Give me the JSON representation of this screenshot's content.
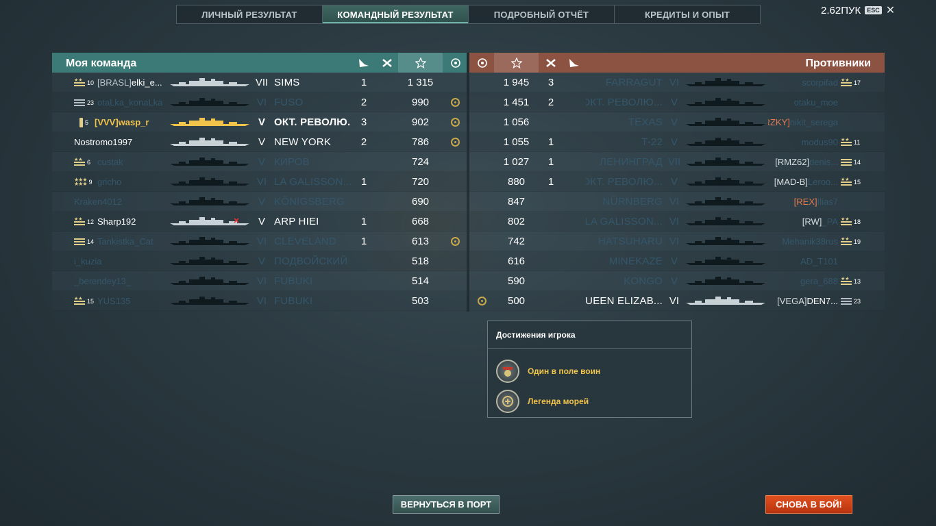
{
  "tabs": [
    {
      "label": "ЛИЧНЫЙ РЕЗУЛЬТАТ",
      "active": false
    },
    {
      "label": "КОМАНДНЫЙ РЕЗУЛЬТАТ",
      "active": true
    },
    {
      "label": "ПОДРОБНЫЙ ОТЧЁТ",
      "active": false
    },
    {
      "label": "КРЕДИТЫ И ОПЫТ",
      "active": false
    }
  ],
  "topbar": {
    "credits": "2.62ПУК",
    "esc_label": "ESC",
    "close_glyph": "✕"
  },
  "my_team": {
    "title": "Моя команда",
    "header_icons": [
      "ship-kill-icon",
      "plane-kill-icon",
      "star-icon",
      "helm-icon"
    ],
    "rows": [
      {
        "rank_num": "10",
        "insignia": "stripes-stars",
        "clan": "[BRASL]",
        "player": "elki_e...",
        "ship": "SIMS",
        "tier": "VII",
        "kills": "1",
        "plane_kills": "",
        "exp": "1 315",
        "medal": false,
        "alive": true,
        "me": false
      },
      {
        "rank_num": "23",
        "insignia": "bars",
        "clan": "",
        "player": "otaLka_konaLka",
        "ship": "FUSO",
        "tier": "VI",
        "kills": "2",
        "plane_kills": "",
        "exp": "990",
        "medal": true,
        "alive": false,
        "me": false
      },
      {
        "rank_num": "5",
        "insignia": "pill",
        "clan": "[VVV]",
        "player": "wasp_r",
        "ship": "ОКТ. РЕВОЛЮ...",
        "tier": "V",
        "kills": "3",
        "plane_kills": "",
        "exp": "902",
        "medal": true,
        "alive": true,
        "me": true
      },
      {
        "rank_num": "",
        "insignia": "",
        "clan": "",
        "player": "Nostromo1997",
        "ship": "NEW YORK",
        "tier": "V",
        "kills": "2",
        "plane_kills": "",
        "exp": "786",
        "medal": true,
        "alive": true,
        "me": false
      },
      {
        "rank_num": "6",
        "insignia": "stars-stripes",
        "clan": "",
        "player": "custak",
        "ship": "КИРОВ",
        "tier": "V",
        "kills": "",
        "plane_kills": "",
        "exp": "724",
        "medal": false,
        "alive": false,
        "me": false
      },
      {
        "rank_num": "9",
        "insignia": "stars",
        "clan": "",
        "player": "gricho",
        "ship": "LA GALISSON...",
        "tier": "VI",
        "kills": "1",
        "plane_kills": "",
        "exp": "720",
        "medal": false,
        "alive": false,
        "me": false
      },
      {
        "rank_num": "",
        "insignia": "",
        "clan": "",
        "player": "Kraken4012",
        "ship": "KÖNIGSBERG",
        "tier": "V",
        "kills": "",
        "plane_kills": "",
        "exp": "690",
        "medal": false,
        "alive": false,
        "me": false
      },
      {
        "rank_num": "12",
        "insignia": "stars-stripes",
        "clan": "",
        "player": "Sharp192",
        "ship": "ARP HIEI",
        "tier": "V",
        "kills": "1",
        "plane_kills": "",
        "exp": "668",
        "medal": false,
        "alive": true,
        "me": false
      },
      {
        "rank_num": "14",
        "insignia": "stripes",
        "clan": "",
        "player": "Tankistka_Cat",
        "ship": "CLEVELAND",
        "tier": "VI",
        "kills": "1",
        "plane_kills": "",
        "exp": "613",
        "medal": true,
        "alive": false,
        "me": false
      },
      {
        "rank_num": "",
        "insignia": "",
        "clan": "",
        "player": "i_kuzia",
        "ship": "ПОДВОЙСКИЙ",
        "tier": "V",
        "kills": "",
        "plane_kills": "",
        "exp": "518",
        "medal": false,
        "alive": false,
        "me": false
      },
      {
        "rank_num": "",
        "insignia": "",
        "clan": "",
        "player": "_berendey13_",
        "ship": "FUBUKI",
        "tier": "VI",
        "kills": "",
        "plane_kills": "",
        "exp": "514",
        "medal": false,
        "alive": false,
        "me": false
      },
      {
        "rank_num": "15",
        "insignia": "stars-stripes",
        "clan": "",
        "player": "YUS135",
        "ship": "FUBUKI",
        "tier": "VI",
        "kills": "",
        "plane_kills": "",
        "exp": "503",
        "medal": false,
        "alive": false,
        "me": false
      }
    ]
  },
  "enemies": {
    "title": "Противники",
    "header_icons": [
      "helm-icon",
      "star-icon",
      "plane-kill-icon",
      "ship-kill-icon"
    ],
    "rows": [
      {
        "medal": false,
        "exp": "1 945",
        "plane_kills": "3",
        "kills": "",
        "ship": "FARRAGUT",
        "tier": "VI",
        "clan": "",
        "player": "scorpifad",
        "rank_num": "17",
        "insignia": "stripes-stars",
        "alive": false
      },
      {
        "medal": false,
        "exp": "1 451",
        "plane_kills": "2",
        "kills": "",
        "ship": "ОКТ. РЕВОЛЮ...",
        "tier": "V",
        "clan": "",
        "player": "otaku_moe",
        "rank_num": "",
        "insignia": "",
        "alive": false
      },
      {
        "medal": false,
        "exp": "1 056",
        "plane_kills": "",
        "kills": "",
        "ship": "TEXAS",
        "tier": "V",
        "clan": "[DRZKY]",
        "player": "nikit_serega",
        "rank_num": "",
        "insignia": "",
        "alive": false
      },
      {
        "medal": false,
        "exp": "1 055",
        "plane_kills": "1",
        "kills": "",
        "ship": "T-22",
        "tier": "V",
        "clan": "",
        "player": "modus90",
        "rank_num": "11",
        "insignia": "stripes-stars",
        "alive": false
      },
      {
        "medal": false,
        "exp": "1 027",
        "plane_kills": "1",
        "kills": "",
        "ship": "ЛЕНИНГРАД",
        "tier": "VII",
        "clan": "[RMZ62]",
        "player": "denis...",
        "rank_num": "14",
        "insignia": "stripes",
        "alive": false
      },
      {
        "medal": false,
        "exp": "880",
        "plane_kills": "1",
        "kills": "",
        "ship": "ОКТ. РЕВОЛЮ...",
        "tier": "V",
        "clan": "[MAD-B]",
        "player": "Leroo...",
        "rank_num": "15",
        "insignia": "stars-stripes",
        "alive": false
      },
      {
        "medal": false,
        "exp": "847",
        "plane_kills": "",
        "kills": "",
        "ship": "NÜRNBERG",
        "tier": "VI",
        "clan": "[REX]",
        "player": "Ilias7",
        "rank_num": "",
        "insignia": "",
        "alive": false
      },
      {
        "medal": false,
        "exp": "802",
        "plane_kills": "",
        "kills": "",
        "ship": "LA GALISSON...",
        "tier": "VI",
        "clan": "[RW]",
        "player": "_PA",
        "rank_num": "18",
        "insignia": "stars-stripes",
        "alive": false
      },
      {
        "medal": false,
        "exp": "742",
        "plane_kills": "",
        "kills": "",
        "ship": "HATSUHARU",
        "tier": "VI",
        "clan": "",
        "player": "Mehanik38rus",
        "rank_num": "19",
        "insignia": "stars-stripes",
        "alive": false
      },
      {
        "medal": false,
        "exp": "616",
        "plane_kills": "",
        "kills": "",
        "ship": "MINEKAZE",
        "tier": "V",
        "clan": "",
        "player": "AD_T101",
        "rank_num": "",
        "insignia": "",
        "alive": false
      },
      {
        "medal": false,
        "exp": "590",
        "plane_kills": "",
        "kills": "",
        "ship": "KONGO",
        "tier": "V",
        "clan": "",
        "player": "gera_688",
        "rank_num": "13",
        "insignia": "stars-stripes",
        "alive": false
      },
      {
        "medal": true,
        "exp": "500",
        "plane_kills": "",
        "kills": "",
        "ship": "QUEEN ELIZAB...",
        "tier": "VI",
        "clan": "[VEGA]",
        "player": "DEN7...",
        "rank_num": "23",
        "insignia": "bars",
        "alive": true
      }
    ]
  },
  "achievements": {
    "title": "Достижения игрока",
    "items": [
      {
        "label": "Один в поле воин",
        "icon": "lone-warrior-medal-icon"
      },
      {
        "label": "Легенда морей",
        "icon": "sea-legend-medal-icon"
      }
    ]
  },
  "buttons": {
    "port": "ВЕРНУТЬСЯ В ПОРТ",
    "battle": "СНОВА В БОЙ!"
  },
  "colors": {
    "my_team": "#3b7a76",
    "enemy_team": "#8c5242",
    "gold": "#f2c34a",
    "battle_button": "#d8481a",
    "dead_text": "#34566a",
    "enemy_clan": "#e07a50"
  }
}
